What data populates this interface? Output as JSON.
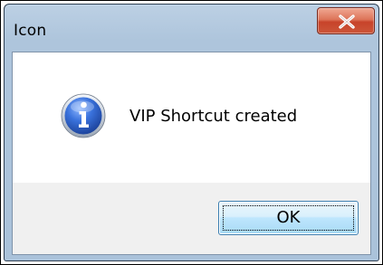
{
  "window": {
    "title": "Icon"
  },
  "title_bar": {
    "close_icon": "close-x-icon"
  },
  "message": {
    "icon": "information-icon",
    "text": "VIP Shortcut created"
  },
  "buttons": {
    "ok_label": "OK"
  },
  "colors": {
    "title_bar": "#b9cee3",
    "close_button": "#c94a30",
    "client_background": "#f0f0f0",
    "message_background": "#ffffff",
    "ok_button_border": "#3c7fb1",
    "info_icon": "#2b63c8"
  }
}
